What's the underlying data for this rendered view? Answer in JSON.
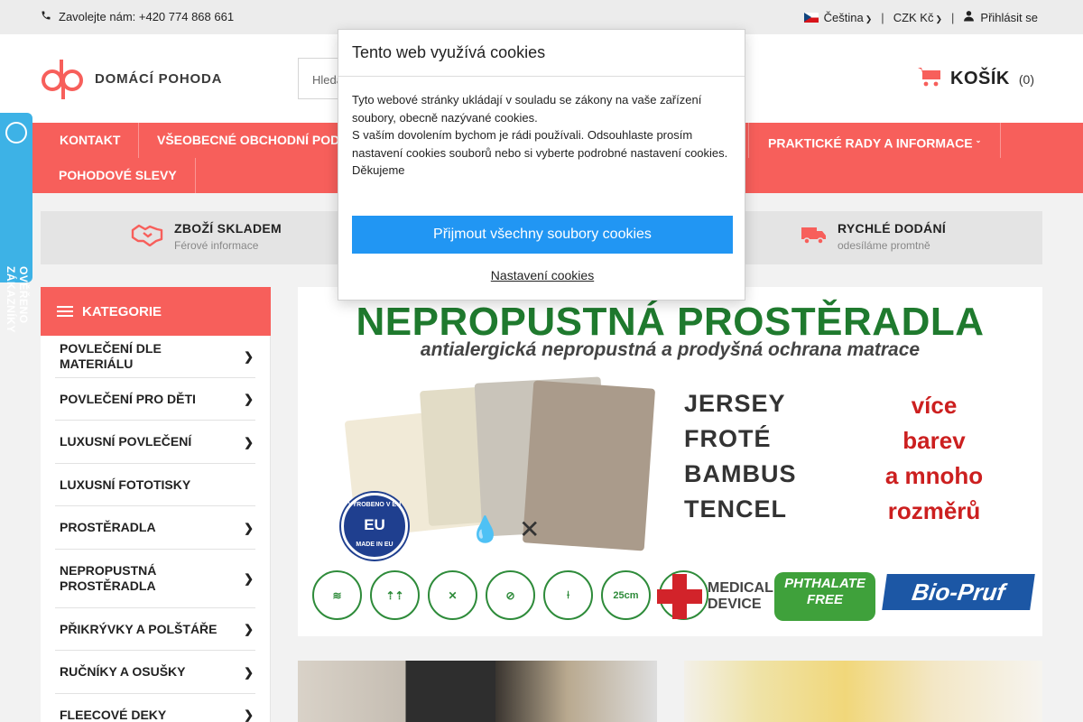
{
  "topbar": {
    "phone_text": "Zavolejte nám: +420 774 868 661",
    "language": "Čeština",
    "currency": "CZK Kč",
    "login": "Přihlásit se"
  },
  "header": {
    "logo_text": "DOMÁCÍ POHODA",
    "search_placeholder": "Hleda",
    "cart_label": "KOŠÍK",
    "cart_count": "(0)"
  },
  "nav": {
    "items": [
      {
        "label": "KONTAKT"
      },
      {
        "label": "VŠEOBECNÉ OBCHODNÍ POD"
      },
      {
        "label": "PRAKTICKÉ RADY A INFORMACE"
      },
      {
        "label": "POHODOVÉ SLEVY"
      }
    ]
  },
  "badge": {
    "text": "OVĚŘENO ZÁKAZNÍKY"
  },
  "benefits": [
    {
      "title": "ZBOŽÍ SKLADEM",
      "subtitle": "Férové informace"
    },
    {
      "title": "RYCHLÉ DODÁNÍ",
      "subtitle": "odesíláme promtně"
    }
  ],
  "categories": {
    "heading": "KATEGORIE",
    "items": [
      {
        "label": "POVLEČENÍ DLE MATERIÁLU"
      },
      {
        "label": "POVLEČENÍ PRO DĚTI"
      },
      {
        "label": "LUXUSNÍ POVLEČENÍ"
      },
      {
        "label": "LUXUSNÍ FOTOTISKY"
      },
      {
        "label": "PROSTĚRADLA"
      },
      {
        "label": "NEPROPUSTNÁ PROSTĚRADLA"
      },
      {
        "label": "PŘIKRÝVKY A POLŠTÁŘE"
      },
      {
        "label": "RUČNÍKY A OSUŠKY"
      },
      {
        "label": "FLEECOVÉ DEKY"
      }
    ]
  },
  "hero": {
    "title": "NEPROPUSTNÁ PROSTĚRADLA",
    "subtitle": "antialergická nepropustná a prodyšná ochrana matrace",
    "fabrics": [
      "JERSEY",
      "FROTÉ",
      "BAMBUS",
      "TENCEL"
    ],
    "red_lines": [
      "více",
      "barev",
      "a mnoho",
      "rozměrů"
    ],
    "seal_top": "VYROBENO V EU",
    "seal_mid": "EU",
    "seal_bottom": "MADE IN EU",
    "temp": "90°",
    "size_mark": "25cm",
    "medical_line1": "MEDICAL",
    "medical_line2": "DEVICE",
    "phthalate_line1": "PHTHALATE",
    "phthalate_line2": "FREE",
    "biopruf": "Bio-Pruf"
  },
  "cookie": {
    "title": "Tento web využívá cookies",
    "body": "Tyto webové stránky ukládají v souladu se zákony na vaše zařízení soubory, obecně nazývané cookies.\nS vaším dovolením bychom je rádi používali. Odsouhlaste prosím nastavení cookies souborů nebo si vyberte podrobné nastavení cookies.\nDěkujeme",
    "accept": "Přijmout všechny soubory cookies",
    "settings": "Nastavení cookies"
  },
  "colors": {
    "brand_red": "#f75f5b",
    "accept_blue": "#2196f3",
    "badge_blue": "#3db2e6",
    "hero_green": "#1f7a2e"
  }
}
